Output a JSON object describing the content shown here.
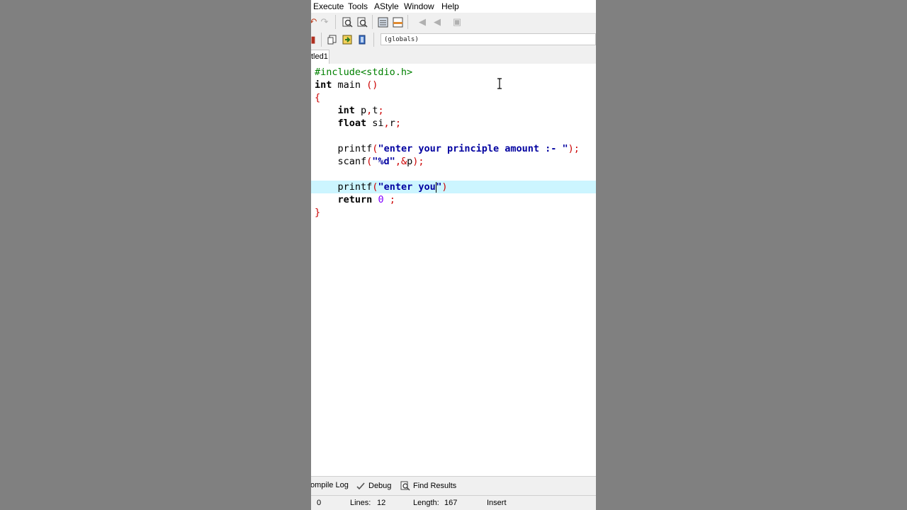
{
  "menu": [
    "Execute",
    "Tools",
    "AStyle",
    "Window",
    "Help"
  ],
  "toolbar": {
    "globals_value": "(globals)"
  },
  "editor_tab": "tled1",
  "code": {
    "l1": "#include<stdio.h>",
    "l2_kw": "int",
    "l2_rest": " main ",
    "l2_sym": "()",
    "l3": "{",
    "l4_kw": "int",
    "l4_rest": " p",
    "l4_sym1": ",",
    "l4_rest2": "t",
    "l4_sym2": ";",
    "l5_kw": "float",
    "l5_rest": " si",
    "l5_sym1": ",",
    "l5_rest2": "r",
    "l5_sym2": ";",
    "l7_fn": "printf",
    "l7_open": "(",
    "l7_str": "\"enter your principle amount :- \"",
    "l7_close": ");",
    "l8_fn": "scanf",
    "l8_open": "(",
    "l8_str": "\"%d\"",
    "l8_mid": ",&",
    "l8_var": "p",
    "l8_close": ");",
    "l10_fn": "printf",
    "l10_open": "(",
    "l10_str_a": "\"enter you",
    "l10_str_b": "\"",
    "l10_close": ")",
    "l11_kw": "return",
    "l11_num": "0",
    "l11_sym": ";",
    "l12": "}"
  },
  "bottom_tabs": {
    "compile_log": "ompile Log",
    "debug": "Debug",
    "find_results": "Find Results"
  },
  "status": {
    "col": "0",
    "lines_label": "Lines:",
    "lines_value": "12",
    "length_label": "Length:",
    "length_value": "167",
    "mode": "Insert"
  }
}
